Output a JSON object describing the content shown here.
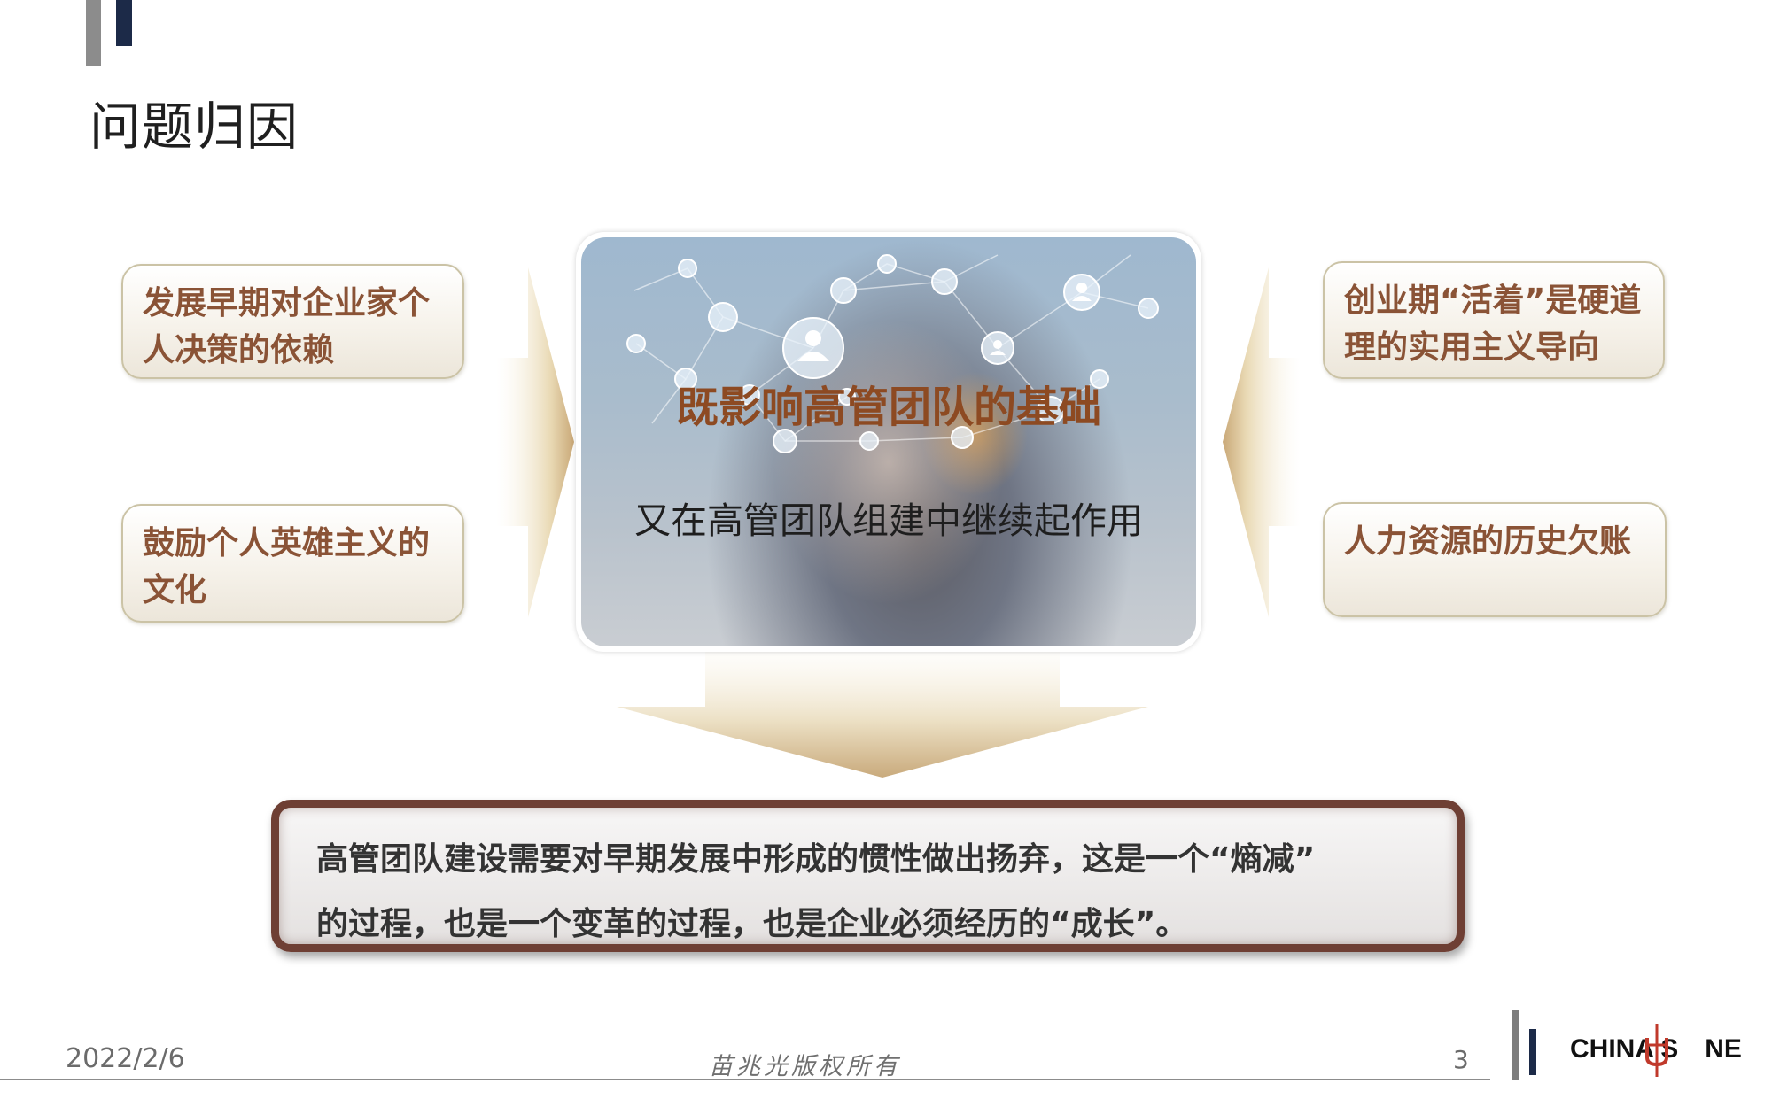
{
  "header": {
    "title": "问题归因"
  },
  "left_boxes": [
    "发展早期对企业家个人决策的依赖",
    "鼓励个人英雄主义的文化"
  ],
  "right_boxes": [
    "创业期“活着”是硬道理的实用主义导向",
    "人力资源的历史欠账"
  ],
  "center": {
    "title": "既影响高管团队的基础",
    "subtitle": "又在高管团队组建中继续起作用"
  },
  "bottom": {
    "line1": "高管团队建设需要对早期发展中形成的惯性做出扬弃，这是一个“熵减”",
    "line2": "的过程，也是一个变革的过程，也是企业必须经历的“成长”。"
  },
  "footer": {
    "date": "2022/2/6",
    "copyright": "苗兆光版权所有",
    "page": "3",
    "logo_left": "CHINA S",
    "logo_right": "NE"
  },
  "colors": {
    "accent_brown": "#8a5336",
    "navy": "#1c2a48",
    "frame_brown": "#6e3f34"
  }
}
